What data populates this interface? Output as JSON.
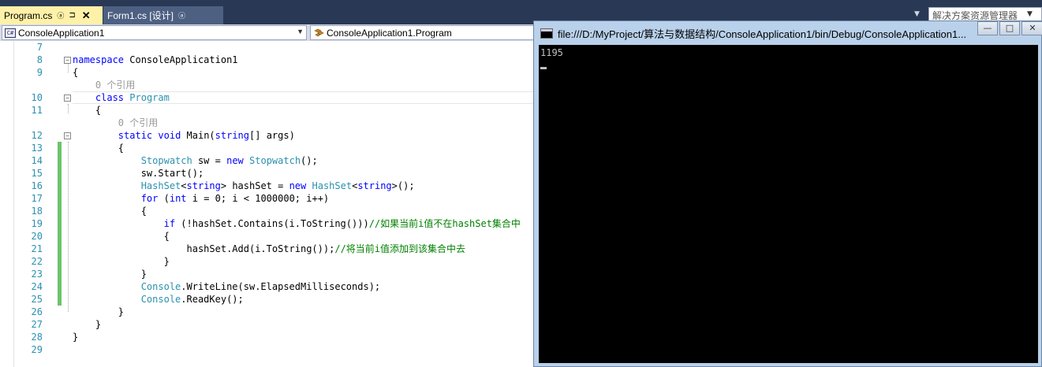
{
  "tabs": [
    {
      "label": "Program.cs",
      "pin": "ⓐ",
      "pushpin": "⊐",
      "close": "✕",
      "active": true
    },
    {
      "label": "Form1.cs [设计]",
      "pin": "ⓐ",
      "active": false
    }
  ],
  "solution_explorer_label": "解决方案资源管理器",
  "nav": {
    "project": "ConsoleApplication1",
    "member": "ConsoleApplication1.Program"
  },
  "code_lines": [
    {
      "num": "7",
      "html": ""
    },
    {
      "num": "8",
      "tokens": [
        [
          "kw",
          "namespace"
        ],
        [
          "",
          " ConsoleApplication1"
        ]
      ]
    },
    {
      "num": "9",
      "tokens": [
        [
          "",
          "{"
        ]
      ]
    },
    {
      "num": "",
      "tokens": [
        [
          "ref",
          "    0 个引用"
        ]
      ]
    },
    {
      "num": "10",
      "tokens": [
        [
          "",
          "    "
        ],
        [
          "kw",
          "class"
        ],
        [
          "",
          " "
        ],
        [
          "ty",
          "Program"
        ]
      ]
    },
    {
      "num": "11",
      "tokens": [
        [
          "",
          "    {"
        ]
      ]
    },
    {
      "num": "",
      "tokens": [
        [
          "ref",
          "        0 个引用"
        ]
      ]
    },
    {
      "num": "12",
      "tokens": [
        [
          "",
          "        "
        ],
        [
          "kw",
          "static"
        ],
        [
          "",
          " "
        ],
        [
          "kw",
          "void"
        ],
        [
          "",
          " Main("
        ],
        [
          "kw",
          "string"
        ],
        [
          "",
          "[] args)"
        ]
      ]
    },
    {
      "num": "13",
      "tokens": [
        [
          "",
          "        {"
        ]
      ]
    },
    {
      "num": "14",
      "tokens": [
        [
          "",
          "            "
        ],
        [
          "ty",
          "Stopwatch"
        ],
        [
          "",
          " sw = "
        ],
        [
          "kw",
          "new"
        ],
        [
          "",
          " "
        ],
        [
          "ty",
          "Stopwatch"
        ],
        [
          "",
          "();"
        ]
      ]
    },
    {
      "num": "15",
      "tokens": [
        [
          "",
          "            sw.Start();"
        ]
      ]
    },
    {
      "num": "16",
      "tokens": [
        [
          "",
          "            "
        ],
        [
          "ty",
          "HashSet"
        ],
        [
          "",
          "<"
        ],
        [
          "kw",
          "string"
        ],
        [
          "",
          "> hashSet = "
        ],
        [
          "kw",
          "new"
        ],
        [
          "",
          " "
        ],
        [
          "ty",
          "HashSet"
        ],
        [
          "",
          "<"
        ],
        [
          "kw",
          "string"
        ],
        [
          "",
          ">();"
        ]
      ]
    },
    {
      "num": "17",
      "tokens": [
        [
          "",
          "            "
        ],
        [
          "kw",
          "for"
        ],
        [
          "",
          " ("
        ],
        [
          "kw",
          "int"
        ],
        [
          "",
          " i = 0; i < 1000000; i++)"
        ]
      ]
    },
    {
      "num": "18",
      "tokens": [
        [
          "",
          "            {"
        ]
      ]
    },
    {
      "num": "19",
      "tokens": [
        [
          "",
          "                "
        ],
        [
          "kw",
          "if"
        ],
        [
          "",
          " (!hashSet.Contains(i.ToString()))"
        ],
        [
          "cm",
          "//如果当前i值不在hashSet集合中"
        ]
      ]
    },
    {
      "num": "20",
      "tokens": [
        [
          "",
          "                {"
        ]
      ]
    },
    {
      "num": "21",
      "tokens": [
        [
          "",
          "                    hashSet.Add(i.ToString());"
        ],
        [
          "cm",
          "//将当前i值添加到该集合中去"
        ]
      ]
    },
    {
      "num": "22",
      "tokens": [
        [
          "",
          "                }"
        ]
      ]
    },
    {
      "num": "23",
      "tokens": [
        [
          "",
          "            }"
        ]
      ]
    },
    {
      "num": "24",
      "tokens": [
        [
          "",
          "            "
        ],
        [
          "ty",
          "Console"
        ],
        [
          "",
          ".WriteLine(sw.ElapsedMilliseconds);"
        ]
      ]
    },
    {
      "num": "25",
      "tokens": [
        [
          "",
          "            "
        ],
        [
          "ty",
          "Console"
        ],
        [
          "",
          ".ReadKey();"
        ]
      ]
    },
    {
      "num": "26",
      "tokens": [
        [
          "",
          "        }"
        ]
      ]
    },
    {
      "num": "27",
      "tokens": [
        [
          "",
          "    }"
        ]
      ]
    },
    {
      "num": "28",
      "tokens": [
        [
          "",
          "}"
        ]
      ]
    },
    {
      "num": "29",
      "tokens": []
    }
  ],
  "console": {
    "title": "file:///D:/MyProject/算法与数据结构/ConsoleApplication1/bin/Debug/ConsoleApplication1...",
    "output": "1195",
    "btn_min": "—",
    "btn_max": "□",
    "btn_close": "✕"
  },
  "colors": {
    "keyword": "#0000ff",
    "type": "#2b91af",
    "comment": "#008000",
    "change_bar": "#6cc46c"
  }
}
